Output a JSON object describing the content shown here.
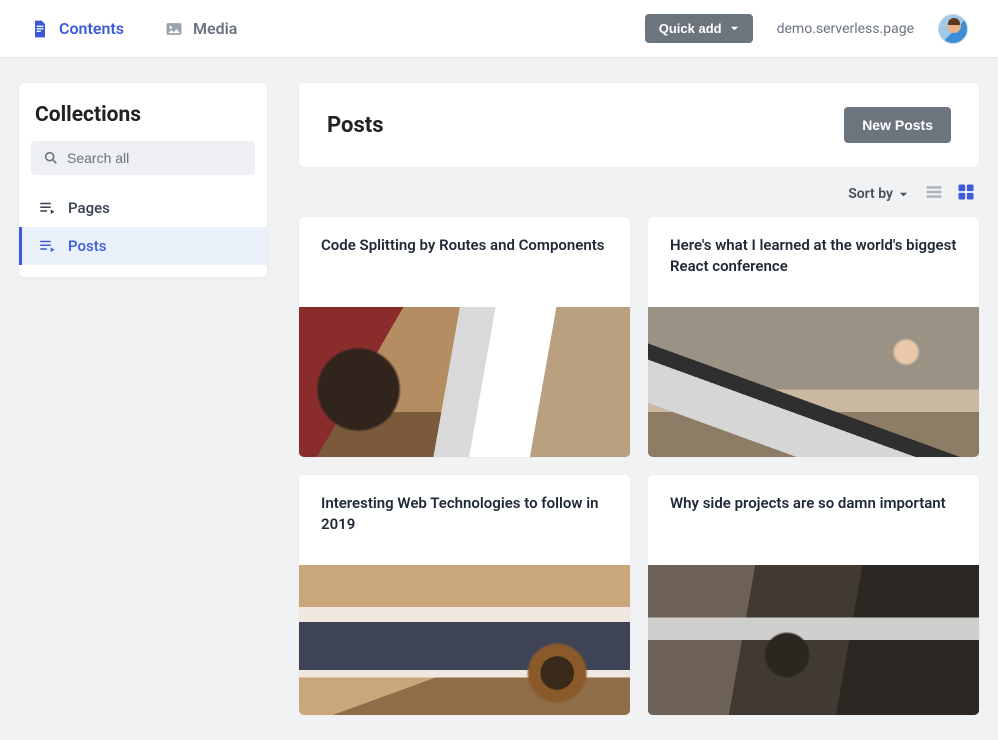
{
  "topnav": {
    "contents": "Contents",
    "media": "Media"
  },
  "quick_add_label": "Quick add",
  "domain_text": "demo.serverless.page",
  "sidebar": {
    "title": "Collections",
    "search_placeholder": "Search all",
    "items": [
      {
        "label": "Pages",
        "active": false
      },
      {
        "label": "Posts",
        "active": true
      }
    ]
  },
  "main": {
    "heading": "Posts",
    "new_button": "New Posts",
    "sort_label": "Sort by",
    "posts": [
      {
        "title": "Code Splitting by Routes and Components"
      },
      {
        "title": "Here's what I learned at the world's biggest React conference"
      },
      {
        "title": "Interesting Web Technologies to follow in 2019"
      },
      {
        "title": "Why side projects are so damn important"
      }
    ]
  }
}
